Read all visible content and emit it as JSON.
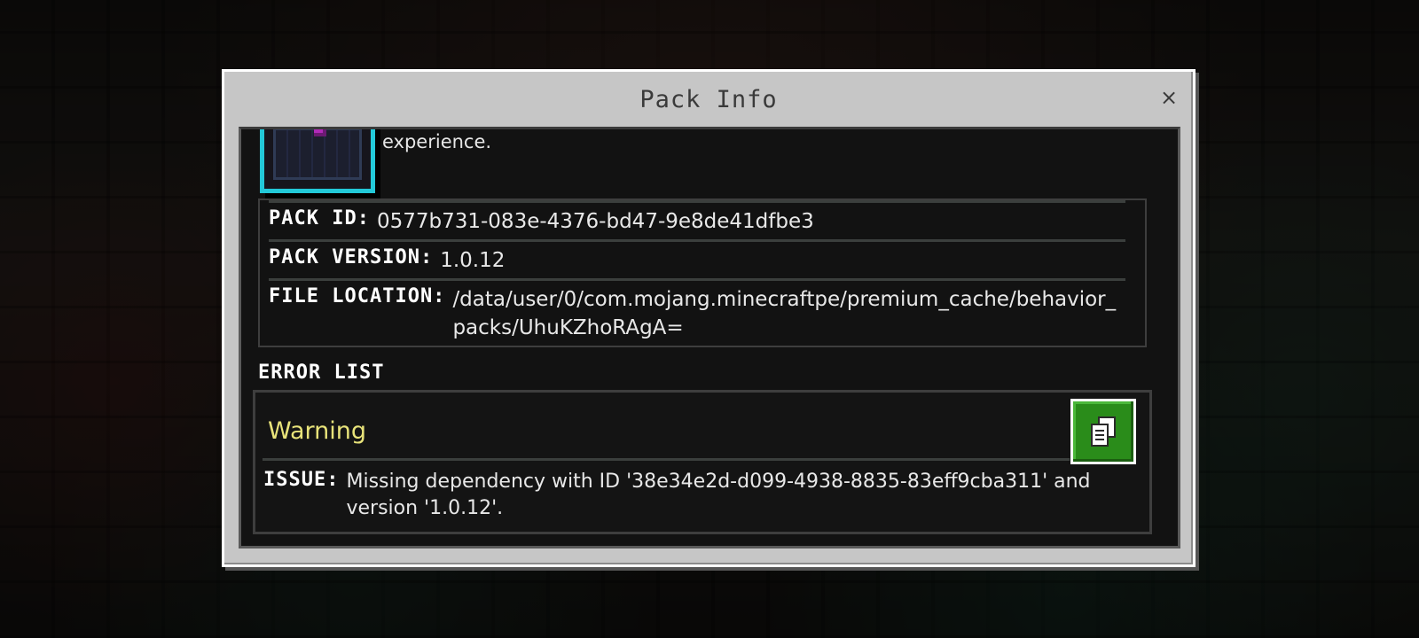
{
  "dialog": {
    "title": "Pack Info",
    "close_label": "×"
  },
  "pack": {
    "description_tail": "experience.",
    "id_label": "PACK ID:",
    "id_value": "0577b731-083e-4376-bd47-9e8de41dfbe3",
    "version_label": "PACK VERSION:",
    "version_value": "1.0.12",
    "location_label": "FILE LOCATION:",
    "location_value": "/data/user/0/com.mojang.minecraftpe/premium_cache/behavior_packs/UhuKZhoRAgA="
  },
  "errors": {
    "heading": "ERROR LIST",
    "items": [
      {
        "severity": "Warning",
        "issue_label": "ISSUE:",
        "issue_text": "Missing dependency with ID '38e34e2d-d099-4938-8835-83eff9cba311' and version '1.0.12'."
      }
    ]
  },
  "icons": {
    "close": "close-icon",
    "copy": "copy-icon",
    "pack": "pack-icon"
  },
  "colors": {
    "warning": "#e8e37a",
    "copy_button": "#2a8c1a",
    "pack_icon_border": "#23c8d8"
  }
}
